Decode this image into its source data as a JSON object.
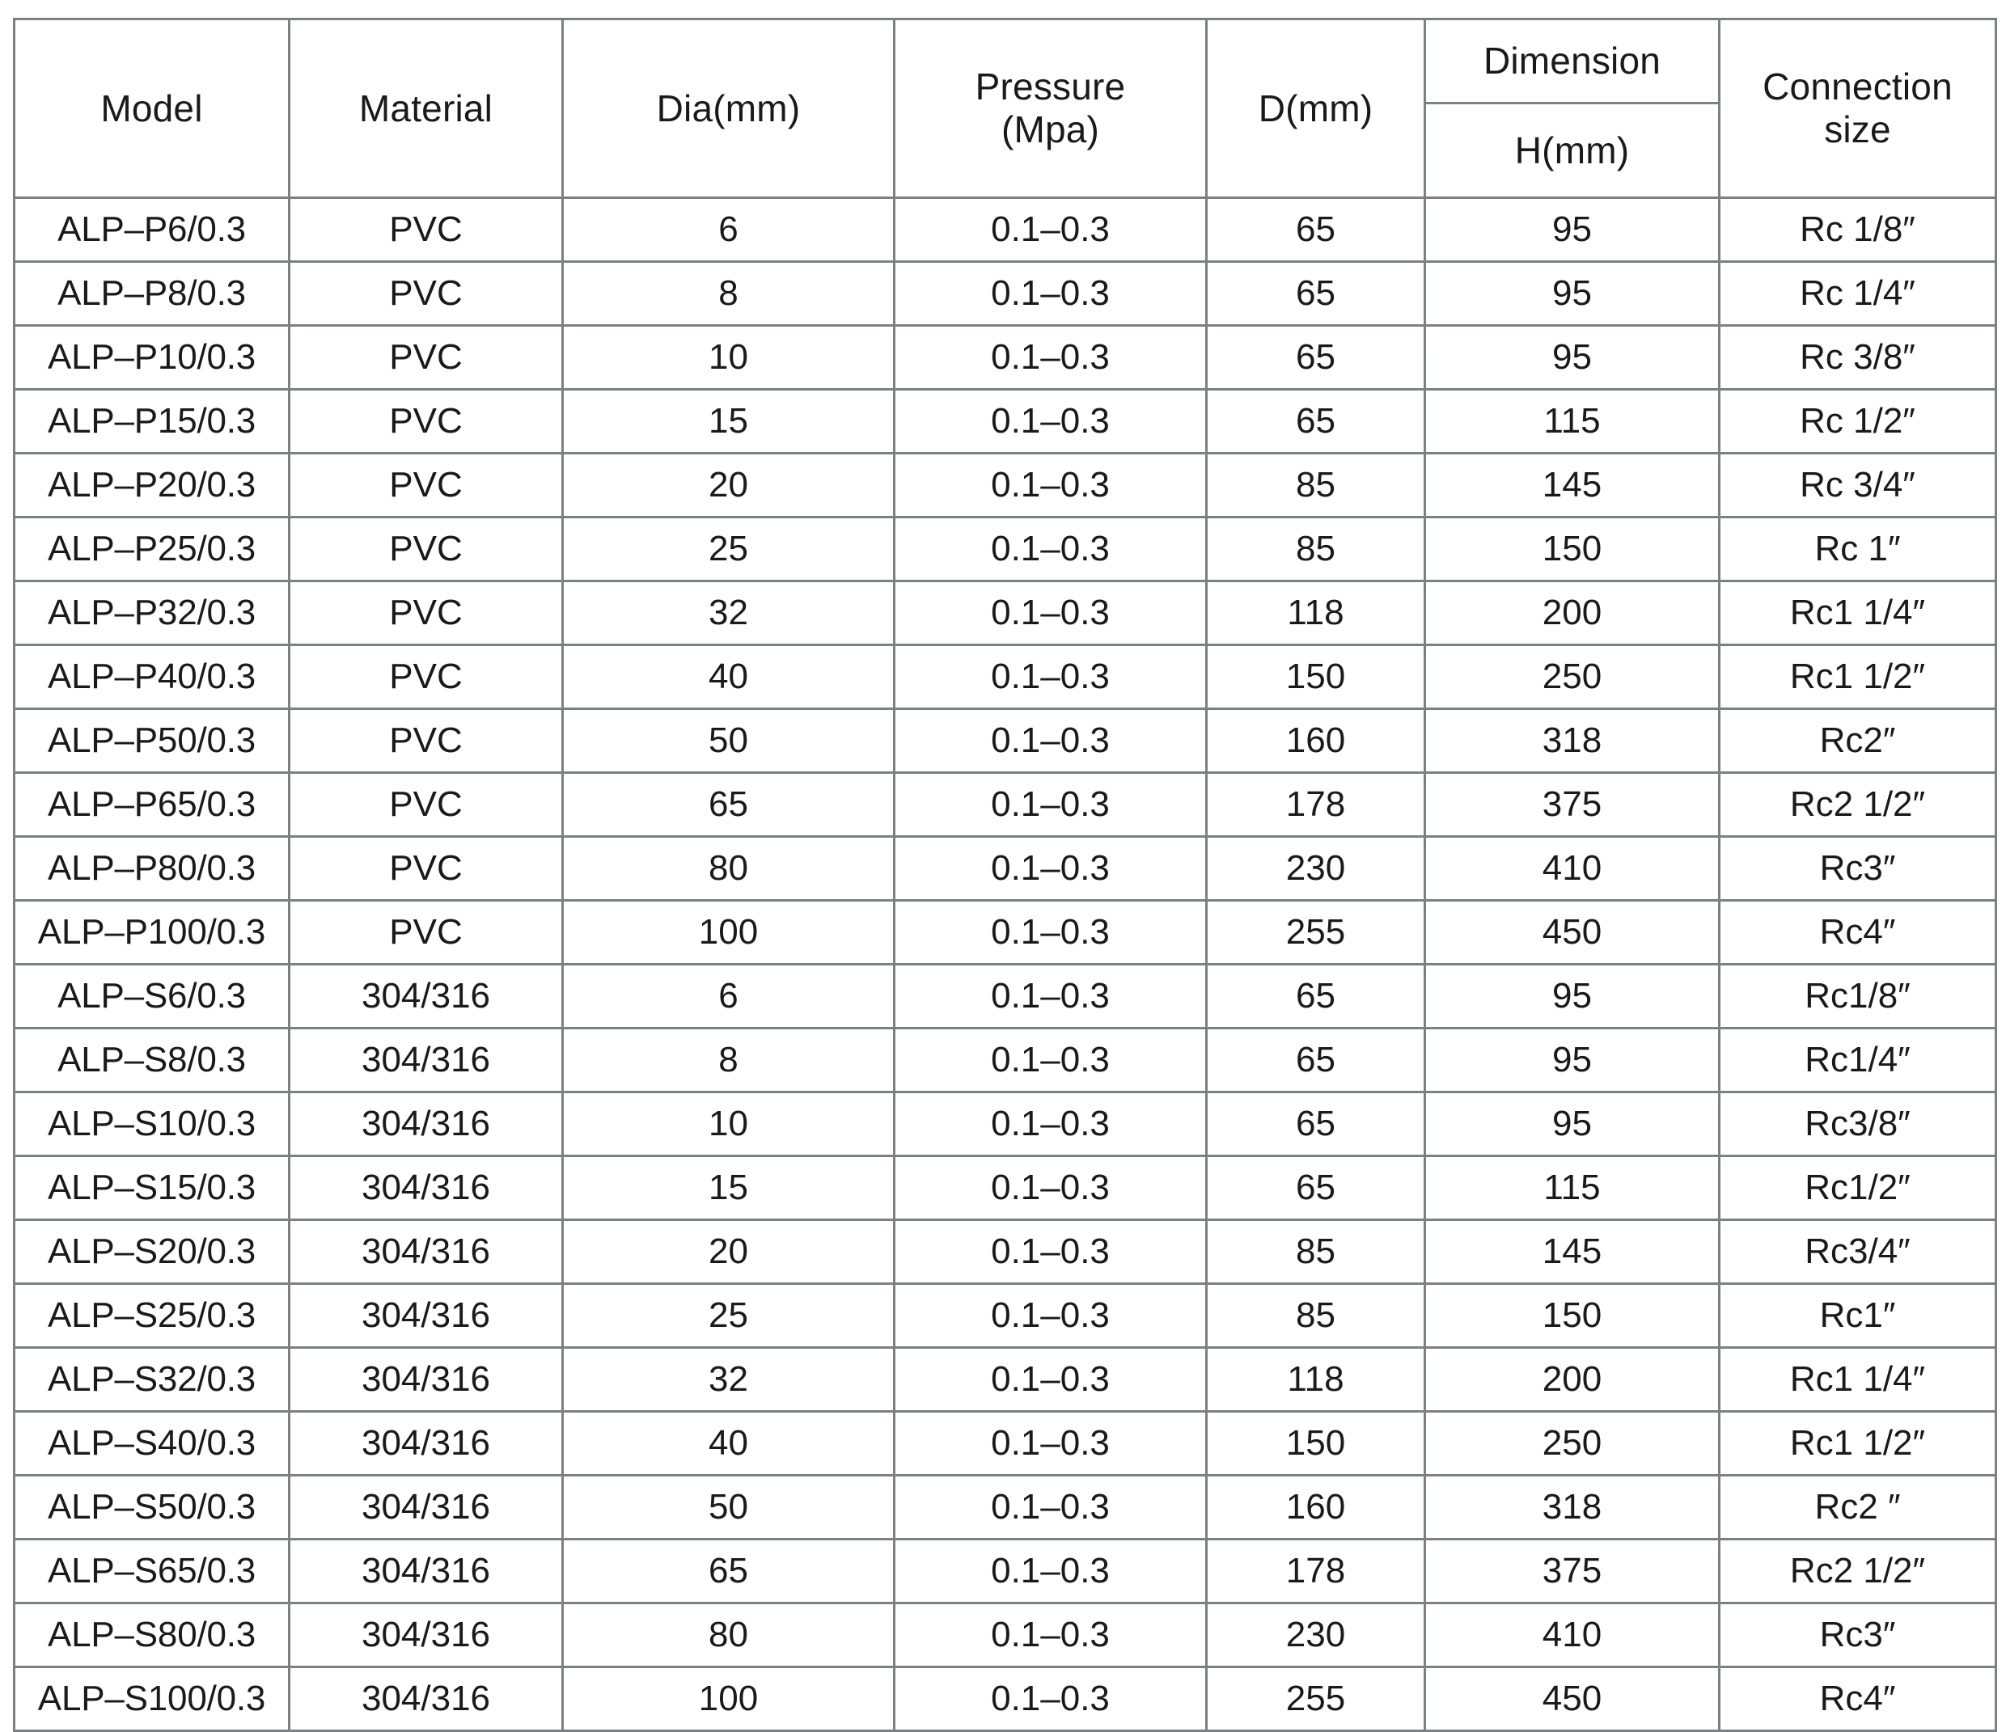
{
  "table": {
    "header": {
      "model": "Model",
      "material": "Material",
      "dia": "Dia(mm)",
      "pressure_line1": "Pressure",
      "pressure_line2": "(Mpa)",
      "d": "D(mm)",
      "dimension": "Dimension",
      "h": "H(mm)",
      "connection_line1": "Connection",
      "connection_line2": "size"
    },
    "colors": {
      "header_background": "#cfeaf8",
      "border": "#7c8084",
      "text": "#1a1a1a",
      "cell_background": "#ffffff"
    },
    "columns": [
      "Model",
      "Material",
      "Dia(mm)",
      "Pressure (Mpa)",
      "D(mm)",
      "Dimension H(mm)",
      "Connection size"
    ],
    "rows": [
      {
        "model": "ALP–P6/0.3",
        "material": "PVC",
        "dia": "6",
        "pressure": "0.1–0.3",
        "d": "65",
        "h": "95",
        "connection": "Rc 1/8″"
      },
      {
        "model": "ALP–P8/0.3",
        "material": "PVC",
        "dia": "8",
        "pressure": "0.1–0.3",
        "d": "65",
        "h": "95",
        "connection": "Rc 1/4″"
      },
      {
        "model": "ALP–P10/0.3",
        "material": "PVC",
        "dia": "10",
        "pressure": "0.1–0.3",
        "d": "65",
        "h": "95",
        "connection": "Rc 3/8″"
      },
      {
        "model": "ALP–P15/0.3",
        "material": "PVC",
        "dia": "15",
        "pressure": "0.1–0.3",
        "d": "65",
        "h": "115",
        "connection": "Rc 1/2″"
      },
      {
        "model": "ALP–P20/0.3",
        "material": "PVC",
        "dia": "20",
        "pressure": "0.1–0.3",
        "d": "85",
        "h": "145",
        "connection": "Rc 3/4″"
      },
      {
        "model": "ALP–P25/0.3",
        "material": "PVC",
        "dia": "25",
        "pressure": "0.1–0.3",
        "d": "85",
        "h": "150",
        "connection": "Rc 1″"
      },
      {
        "model": "ALP–P32/0.3",
        "material": "PVC",
        "dia": "32",
        "pressure": "0.1–0.3",
        "d": "118",
        "h": "200",
        "connection": "Rc1 1/4″"
      },
      {
        "model": "ALP–P40/0.3",
        "material": "PVC",
        "dia": "40",
        "pressure": "0.1–0.3",
        "d": "150",
        "h": "250",
        "connection": "Rc1 1/2″"
      },
      {
        "model": "ALP–P50/0.3",
        "material": "PVC",
        "dia": "50",
        "pressure": "0.1–0.3",
        "d": "160",
        "h": "318",
        "connection": "Rc2″"
      },
      {
        "model": "ALP–P65/0.3",
        "material": "PVC",
        "dia": "65",
        "pressure": "0.1–0.3",
        "d": "178",
        "h": "375",
        "connection": "Rc2 1/2″"
      },
      {
        "model": "ALP–P80/0.3",
        "material": "PVC",
        "dia": "80",
        "pressure": "0.1–0.3",
        "d": "230",
        "h": "410",
        "connection": "Rc3″"
      },
      {
        "model": "ALP–P100/0.3",
        "material": "PVC",
        "dia": "100",
        "pressure": "0.1–0.3",
        "d": "255",
        "h": "450",
        "connection": "Rc4″"
      },
      {
        "model": "ALP–S6/0.3",
        "material": "304/316",
        "dia": "6",
        "pressure": "0.1–0.3",
        "d": "65",
        "h": "95",
        "connection": "Rc1/8″"
      },
      {
        "model": "ALP–S8/0.3",
        "material": "304/316",
        "dia": "8",
        "pressure": "0.1–0.3",
        "d": "65",
        "h": "95",
        "connection": "Rc1/4″"
      },
      {
        "model": "ALP–S10/0.3",
        "material": "304/316",
        "dia": "10",
        "pressure": "0.1–0.3",
        "d": "65",
        "h": "95",
        "connection": "Rc3/8″"
      },
      {
        "model": "ALP–S15/0.3",
        "material": "304/316",
        "dia": "15",
        "pressure": "0.1–0.3",
        "d": "65",
        "h": "115",
        "connection": "Rc1/2″"
      },
      {
        "model": "ALP–S20/0.3",
        "material": "304/316",
        "dia": "20",
        "pressure": "0.1–0.3",
        "d": "85",
        "h": "145",
        "connection": "Rc3/4″"
      },
      {
        "model": "ALP–S25/0.3",
        "material": "304/316",
        "dia": "25",
        "pressure": "0.1–0.3",
        "d": "85",
        "h": "150",
        "connection": "Rc1″"
      },
      {
        "model": "ALP–S32/0.3",
        "material": "304/316",
        "dia": "32",
        "pressure": "0.1–0.3",
        "d": "118",
        "h": "200",
        "connection": "Rc1 1/4″"
      },
      {
        "model": "ALP–S40/0.3",
        "material": "304/316",
        "dia": "40",
        "pressure": "0.1–0.3",
        "d": "150",
        "h": "250",
        "connection": "Rc1 1/2″"
      },
      {
        "model": "ALP–S50/0.3",
        "material": "304/316",
        "dia": "50",
        "pressure": "0.1–0.3",
        "d": "160",
        "h": "318",
        "connection": "Rc2 ″"
      },
      {
        "model": "ALP–S65/0.3",
        "material": "304/316",
        "dia": "65",
        "pressure": "0.1–0.3",
        "d": "178",
        "h": "375",
        "connection": "Rc2 1/2″"
      },
      {
        "model": "ALP–S80/0.3",
        "material": "304/316",
        "dia": "80",
        "pressure": "0.1–0.3",
        "d": "230",
        "h": "410",
        "connection": "Rc3″"
      },
      {
        "model": "ALP–S100/0.3",
        "material": "304/316",
        "dia": "100",
        "pressure": "0.1–0.3",
        "d": "255",
        "h": "450",
        "connection": "Rc4″"
      }
    ]
  }
}
